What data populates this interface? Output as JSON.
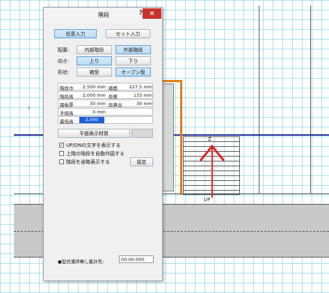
{
  "dialog": {
    "title": "階段",
    "help_icon": "?",
    "close_icon": "×",
    "mode_free": "任意入力",
    "mode_set": "セット入力",
    "placement_label": "配置:",
    "placement_inner": "内部階段",
    "placement_outer": "外部階段",
    "direction_label": "向き:",
    "direction_up": "上り",
    "direction_down": "下り",
    "shape_label": "形状:",
    "shape_box": "箱型",
    "shape_open": "オープン型",
    "params": [
      {
        "label": "階段巾",
        "value": "2,500 mm",
        "label2": "踏面",
        "value2": "227.5 mm"
      },
      {
        "label": "階段高",
        "value": "2,000 mm",
        "label2": "段差",
        "value2": "133 mm"
      },
      {
        "label": "踏板厚",
        "value": "30 mm",
        "label2": "段鼻出",
        "value2": "30 mm"
      },
      {
        "label": "手摺高",
        "value": "0 mm",
        "label2": "",
        "value2": ""
      },
      {
        "label": "最低高",
        "value": "2,000",
        "label2": "",
        "value2": ""
      }
    ],
    "material_label": "平面表示材質",
    "check_updn": "UP/DNの文字を表示する",
    "check_updn_state": "✓",
    "check_auto": "上階の階段を自動作図する",
    "check_abbrev": "階段を省略表示する",
    "settings_button": "設定",
    "footer_label": "●型式灌評無し集計先:",
    "footer_value": "00-00-000"
  },
  "canvas": {
    "updn_label": "UP",
    "updn_top": "Z",
    "small_mark": "o"
  },
  "colors": {
    "grid": "#00b4c8",
    "wall_gray": "#c8c8c8",
    "accent_orange": "#e07a10",
    "arrow_red": "#e02020",
    "blue_line": "#1a2a8c",
    "close_red": "#c9302c",
    "selected_blue": "#b9dcf5"
  }
}
